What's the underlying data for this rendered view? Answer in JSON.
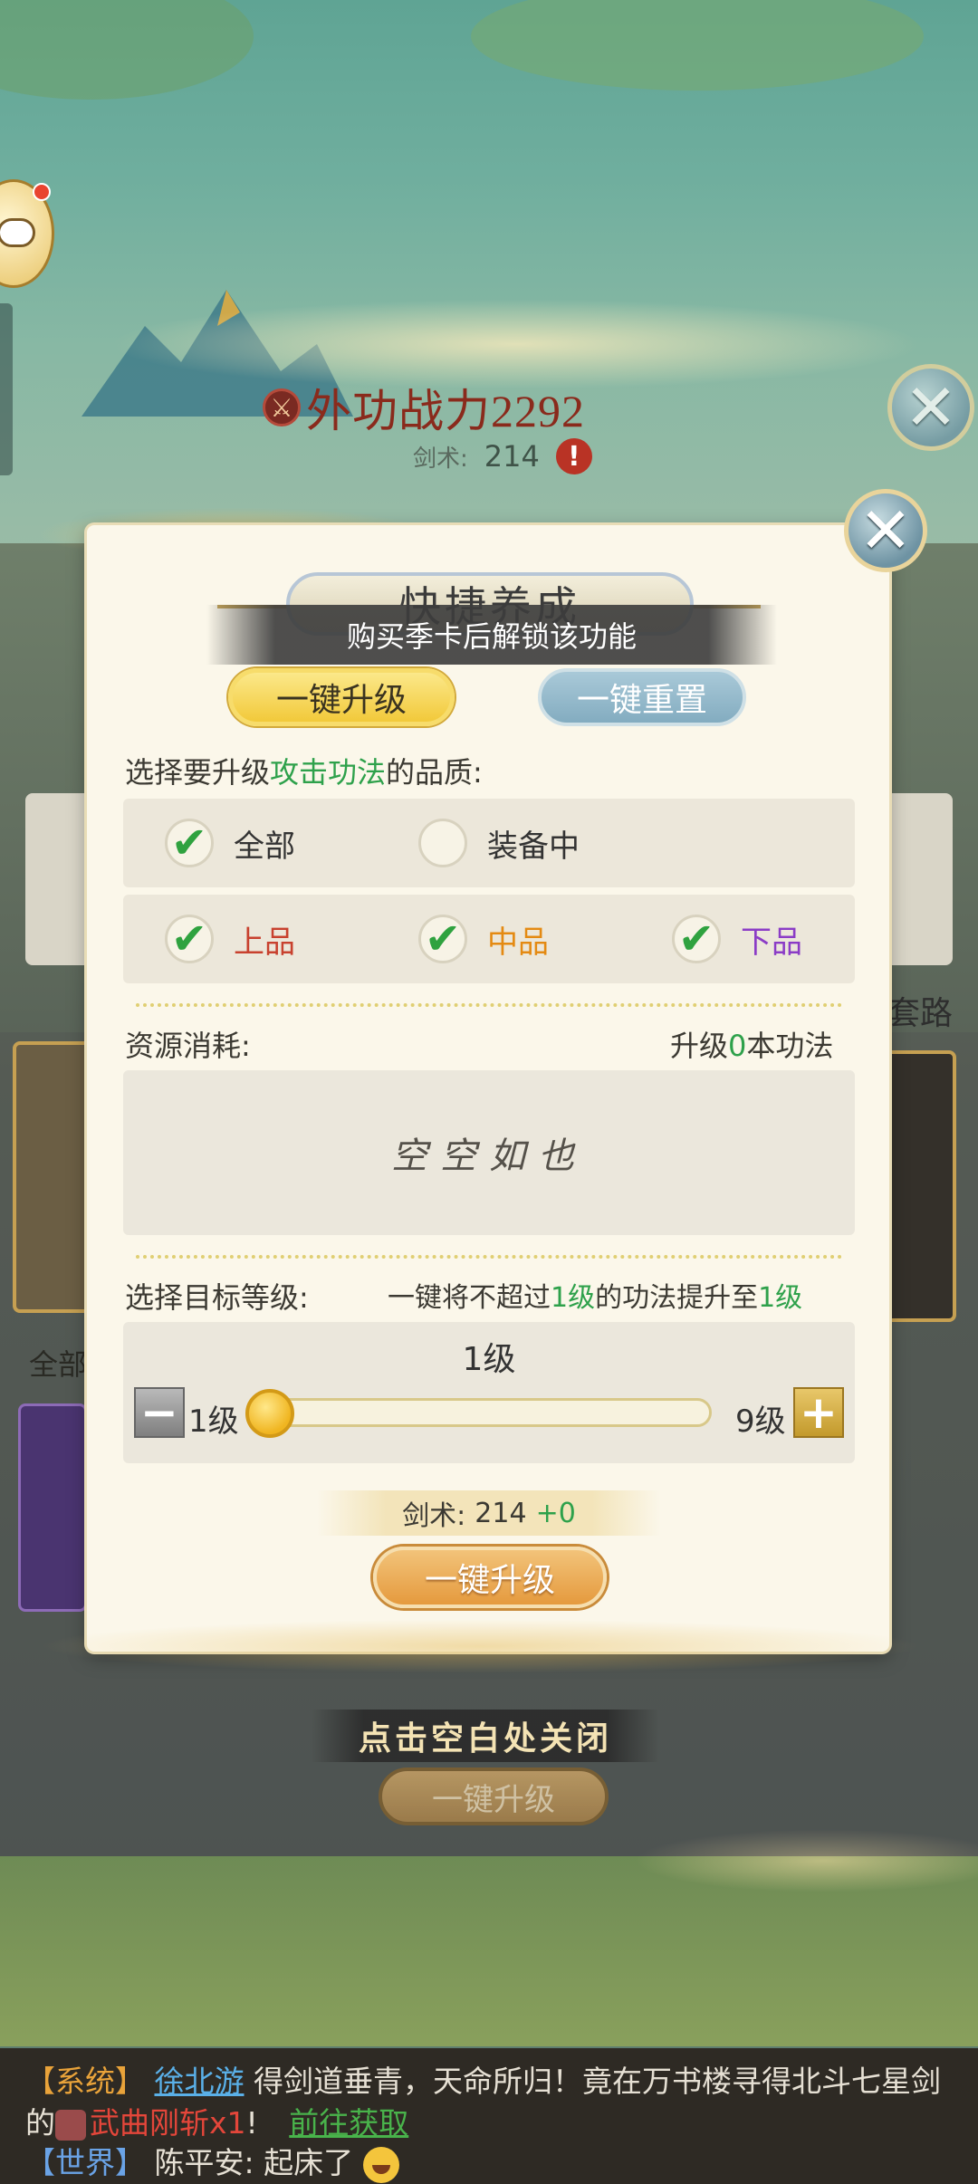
{
  "hud": {
    "power_label": "外功战力2292",
    "skill_label": "剑术:",
    "skill_value": "214",
    "warn": "!"
  },
  "underlay": {
    "taolu": "套路",
    "quanbu": "全部",
    "hint": "点击空白处关闭",
    "btn": "一键升级"
  },
  "dialog": {
    "title": "快捷养成",
    "lock_text": "购买季卡后解锁该功能",
    "tabs": [
      {
        "label": "一键升级",
        "active": true
      },
      {
        "label": "一键重置",
        "active": false
      }
    ],
    "quality": {
      "prefix": "选择要升级",
      "highlight": "攻击功法",
      "suffix": "的品质:",
      "row1": [
        {
          "label": "全部",
          "checked": true
        },
        {
          "label": "装备中",
          "checked": false
        }
      ],
      "row2": [
        {
          "label": "上品",
          "checked": true
        },
        {
          "label": "中品",
          "checked": true
        },
        {
          "label": "下品",
          "checked": true
        }
      ]
    },
    "resources": {
      "label": "资源消耗:",
      "count_prefix": "升级",
      "count": "0",
      "count_suffix": "本功法",
      "empty": "空空如也"
    },
    "target": {
      "label": "选择目标等级:",
      "desc_prefix": "一键将不超过",
      "desc_level1": "1级",
      "desc_mid": "的功法提升至",
      "desc_level2": "1级",
      "current": "1级",
      "min_label": "1级",
      "max_label": "9级",
      "min": 1,
      "max": 9,
      "value": 1
    },
    "cost": {
      "label": "剑术:",
      "value": "214",
      "delta": "+0"
    },
    "confirm_label": "一键升级",
    "check_glyph": "✔",
    "close_glyph": "✕"
  },
  "chat": {
    "line1": {
      "channel": "【系统】",
      "player": "徐北游",
      "text": "得剑道垂青，天命所归！竟在万书楼寻得北斗七星剑"
    },
    "line2": {
      "pre": "的",
      "item": "武曲刚斩x1",
      "mid": "!",
      "link": "前往获取"
    },
    "line3": {
      "channel": "【世界】",
      "text": "陈平安: 起床了"
    }
  }
}
